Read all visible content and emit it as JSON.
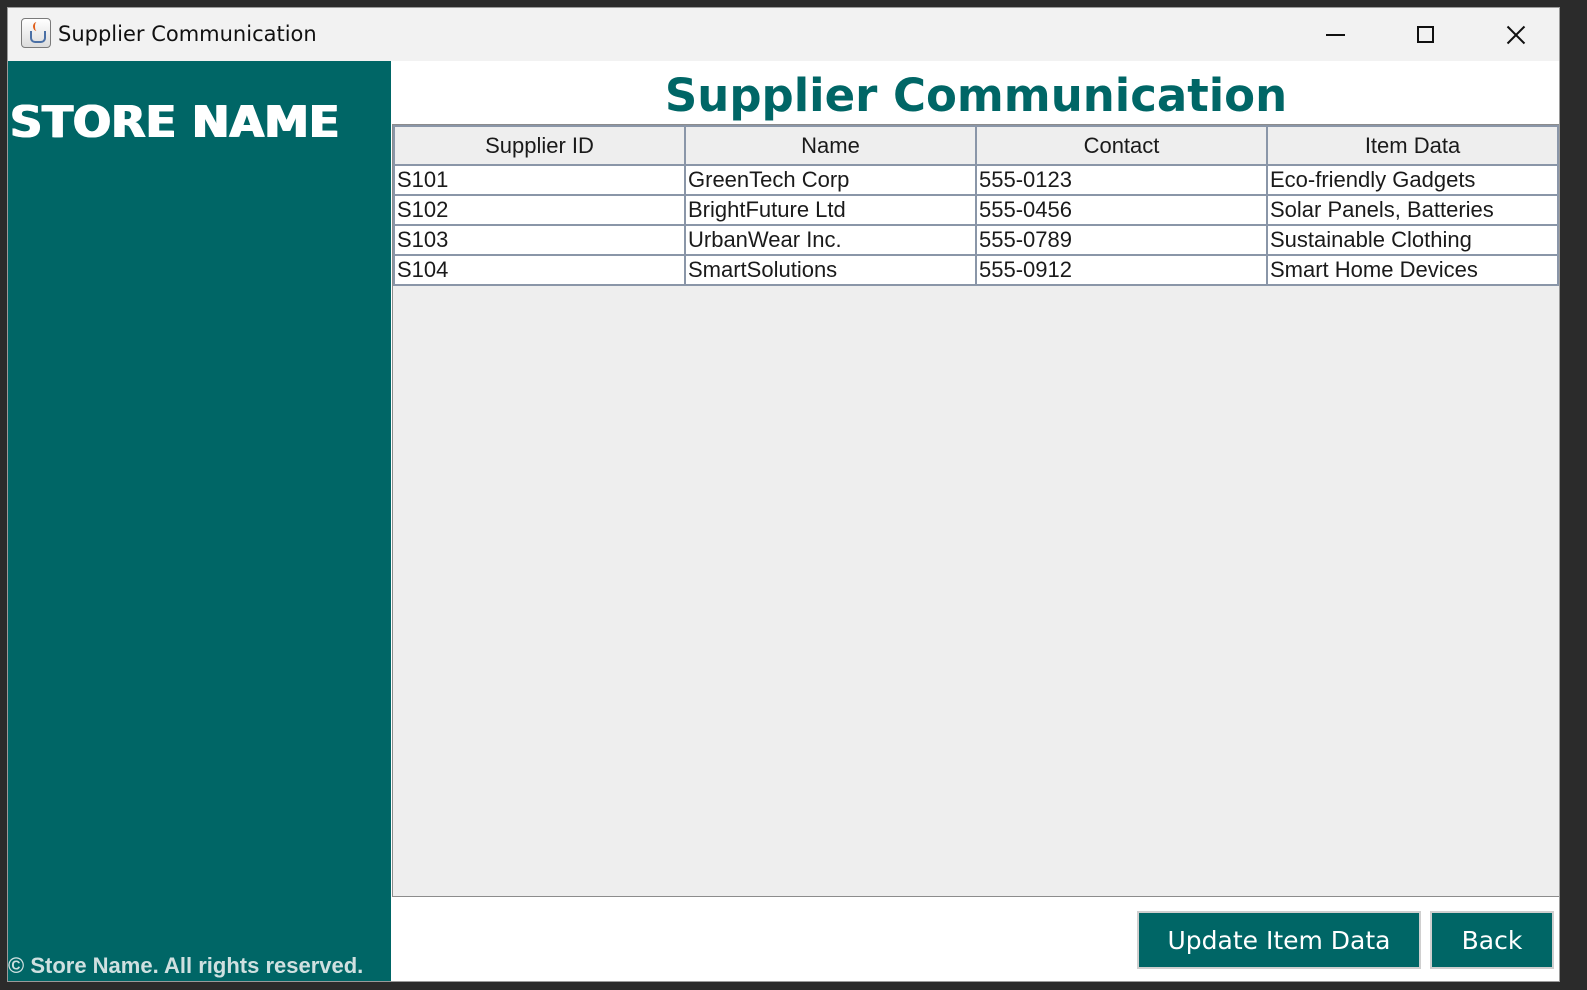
{
  "window": {
    "title": "Supplier Communication",
    "controls": [
      "minimize",
      "maximize",
      "close"
    ]
  },
  "sidebar": {
    "store_name": "STORE NAME",
    "footer": "© Store Name. All rights reserved."
  },
  "main": {
    "title": "Supplier Communication",
    "table": {
      "columns": [
        "Supplier ID",
        "Name",
        "Contact",
        "Item Data"
      ],
      "rows": [
        [
          "S101",
          "GreenTech Corp",
          "555-0123",
          "Eco-friendly Gadgets"
        ],
        [
          "S102",
          "BrightFuture Ltd",
          "555-0456",
          "Solar Panels, Batteries"
        ],
        [
          "S103",
          "UrbanWear Inc.",
          "555-0789",
          "Sustainable Clothing"
        ],
        [
          "S104",
          "SmartSolutions",
          "555-0912",
          "Smart Home Devices"
        ]
      ]
    },
    "buttons": {
      "update_label": "Update Item Data",
      "back_label": "Back"
    }
  },
  "colors": {
    "accent": "#006666",
    "table_border": "#8a96a8",
    "table_background": "#eeeeee"
  },
  "icons": {
    "app": "java-cup-icon",
    "minimize": "minimize-icon",
    "maximize": "maximize-icon",
    "close": "close-icon"
  }
}
